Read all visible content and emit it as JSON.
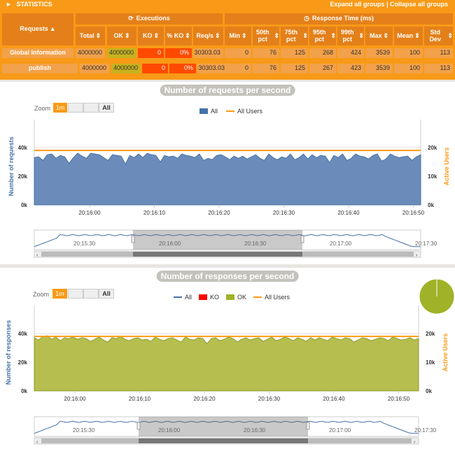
{
  "stats": {
    "title": "STATISTICS",
    "expand_label": "Expand all groups",
    "separator": " | ",
    "collapse_label": "Collapse all groups",
    "executions_label": "Executions",
    "response_time_label": "Response Time (ms)",
    "columns": [
      "Requests",
      "Total",
      "OK",
      "KO",
      "% KO",
      "Req/s",
      "Min",
      "50th pct",
      "75th pct",
      "95th pct",
      "99th pct",
      "Max",
      "Mean",
      "Std Dev"
    ],
    "rows": [
      {
        "name": "Global Information",
        "values": [
          "4000000",
          "4000000",
          "0",
          "0%",
          "30303.03",
          "0",
          "76",
          "125",
          "268",
          "424",
          "3539",
          "100",
          "113"
        ]
      },
      {
        "name": "publish",
        "values": [
          "4000000",
          "4000000",
          "0",
          "0%",
          "30303.03",
          "0",
          "76",
          "125",
          "267",
          "423",
          "3539",
          "100",
          "113"
        ]
      }
    ],
    "colors": {
      "header": "#e4801a",
      "background": "#f89a17",
      "ko": "#ff4a00",
      "ok": "#c8b21d"
    }
  },
  "requests_chart": {
    "title": "Number of requests per second",
    "zoom_label": "Zoom",
    "zoom_options": [
      "1m",
      "",
      "",
      "All"
    ],
    "legend": [
      "All",
      "All Users"
    ],
    "ylabel": "Number of requests",
    "y2label": "Active Users",
    "y_ticks": [
      "0k",
      "20k",
      "40k"
    ],
    "y2_ticks": [
      "0k",
      "10k",
      "20k"
    ],
    "x_ticks": [
      "20:16:00",
      "20:16:10",
      "20:16:20",
      "20:16:30",
      "20:16:40",
      "20:16:50"
    ],
    "nav_ticks": [
      "20:15:30",
      "20:16:00",
      "20:16:30",
      "20:17:00",
      "20:17:30"
    ]
  },
  "responses_chart": {
    "title": "Number of responses per second",
    "zoom_label": "Zoom",
    "zoom_options": [
      "1m",
      "",
      "",
      "All"
    ],
    "legend": [
      "All",
      "KO",
      "OK",
      "All Users"
    ],
    "ylabel": "Number of responses",
    "y2label": "Active Users",
    "y_ticks": [
      "0k",
      "20k",
      "40k"
    ],
    "y2_ticks": [
      "0k",
      "10k",
      "20k"
    ],
    "x_ticks": [
      "20:16:00",
      "20:16:10",
      "20:16:20",
      "20:16:30",
      "20:16:40",
      "20:16:50"
    ],
    "nav_ticks": [
      "20:15:30",
      "20:16:00",
      "20:16:30",
      "20:17:00",
      "20:17:30"
    ]
  },
  "chart_data": [
    {
      "type": "area",
      "title": "Number of requests per second",
      "ylabel": "Number of requests",
      "ylim": [
        0,
        40000
      ],
      "series": [
        {
          "name": "All",
          "values": [
            33000,
            33500,
            31000,
            35000,
            35500,
            32500,
            34500,
            33500,
            29000,
            33000,
            36000,
            34000,
            32500,
            36000,
            35500,
            35000,
            33000,
            31000,
            35000,
            34500,
            34000,
            28500,
            34500,
            33000,
            35500,
            33000,
            36000,
            35000,
            34500,
            30000,
            34500,
            33500,
            34000,
            32500,
            35500,
            34500,
            34000,
            33000,
            35500,
            31000,
            32500,
            31500,
            34500,
            35000,
            33500,
            31500,
            34000,
            32500,
            34000,
            32000,
            33500,
            35000,
            32500,
            31000,
            35500,
            33000,
            31500,
            33500,
            32500,
            35500,
            31500,
            33000,
            35500,
            32000,
            35000,
            33000,
            34500,
            34000,
            29500,
            34500,
            33000,
            35500,
            31000,
            32500,
            35500,
            34000,
            33500,
            32000,
            34500,
            35500,
            30500,
            32000,
            35500,
            34000,
            33000,
            33500,
            34000,
            31000,
            33500,
            35000
          ]
        },
        {
          "name": "All Users",
          "values": [
            19000
          ]
        }
      ]
    },
    {
      "type": "area",
      "title": "Number of responses per second",
      "ylabel": "Number of responses",
      "ylim": [
        0,
        40000
      ],
      "series": [
        {
          "name": "All",
          "values": [
            37000,
            35500,
            38000,
            38500,
            36000,
            37500,
            35000,
            37000,
            36500,
            37500,
            36000,
            37000,
            36500,
            34500,
            36000,
            37500,
            35500,
            34000,
            37000,
            36500,
            38000,
            36000,
            35000,
            36500,
            37000,
            35500,
            36000,
            34500,
            37500,
            36000,
            35000,
            36500,
            37000,
            35500,
            34000,
            37500,
            36000,
            35500,
            37000,
            36500,
            33000,
            36500,
            37000,
            35000,
            36000,
            37500,
            36500,
            34000,
            36000,
            37000,
            35500,
            36500,
            37000,
            34500,
            36000,
            37500,
            35000,
            36000,
            37500,
            36500,
            35000,
            37000,
            36000,
            34500,
            37000,
            35500,
            37000,
            36000,
            35000,
            37500,
            36500,
            35500,
            37000,
            36500,
            34000,
            35500,
            37000,
            36500,
            35000,
            36000,
            37000,
            36500,
            35000,
            37500,
            36500,
            35500,
            36000,
            37000,
            35500,
            36500
          ]
        },
        {
          "name": "KO",
          "values": [
            0
          ]
        },
        {
          "name": "OK",
          "values": [
            37000,
            35500,
            38000,
            38500,
            36000,
            37500,
            35000,
            37000,
            36500,
            37500,
            36000,
            37000,
            36500,
            34500,
            36000,
            37500,
            35500,
            34000,
            37000,
            36500,
            38000,
            36000,
            35000,
            36500,
            37000,
            35500,
            36000,
            34500,
            37500,
            36000,
            35000,
            36500,
            37000,
            35500,
            34000,
            37500,
            36000,
            35500,
            37000,
            36500,
            33000,
            36500,
            37000,
            35000,
            36000,
            37500,
            36500,
            34000,
            36000,
            37000,
            35500,
            36500,
            37000,
            34500,
            36000,
            37500,
            35000,
            36000,
            37500,
            36500,
            35000,
            37000,
            36000,
            34500,
            37000,
            35500,
            37000,
            36000,
            35000,
            37500,
            36500,
            35500,
            37000,
            36500,
            34000,
            35500,
            37000,
            36500,
            35000,
            36000,
            37000,
            36500,
            35000,
            37500,
            36500,
            35500,
            36000,
            37000,
            35500,
            36500
          ]
        },
        {
          "name": "All Users",
          "values": [
            19000
          ]
        }
      ]
    }
  ]
}
